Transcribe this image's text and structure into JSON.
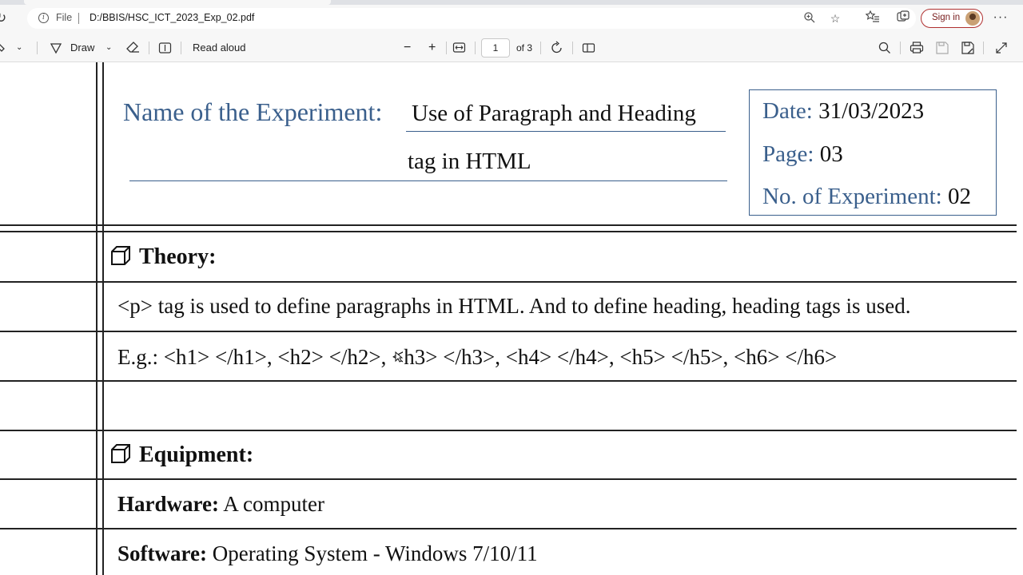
{
  "browser": {
    "scheme_label": "File",
    "url": "D:/BBIS/HSC_ICT_2023_Exp_02.pdf",
    "sign_in_label": "Sign in"
  },
  "pdf_toolbar": {
    "draw_label": "Draw",
    "read_aloud_label": "Read aloud",
    "zoom_out": "−",
    "zoom_in": "+",
    "current_page": "1",
    "page_count": "of 3"
  },
  "document": {
    "experiment": {
      "label": "Name of the Experiment:",
      "line1": "Use of Paragraph and Heading",
      "line2": "tag in HTML"
    },
    "info": {
      "date_label": "Date:",
      "date_value": "31/03/2023",
      "page_label": "Page:",
      "page_value": "03",
      "number_label": "No. of Experiment:",
      "number_value": "02"
    },
    "theory": {
      "title": "Theory:",
      "line1": "<p> tag is used to define paragraphs in HTML. And to define heading, heading tags is used.",
      "line2": "E.g.: <h1> </h1>, <h2> </h2>, <h3> </h3>, <h4> </h4>, <h5> </h5>, <h6> </h6>"
    },
    "equipment": {
      "title": "Equipment:",
      "hardware_label": "Hardware:",
      "hardware_value": "A computer",
      "software_label": "Software:",
      "software_value": "Operating System - Windows 7/10/11"
    }
  },
  "colors": {
    "heading_blue": "#3a5f8c",
    "signin_border": "#b03030"
  }
}
